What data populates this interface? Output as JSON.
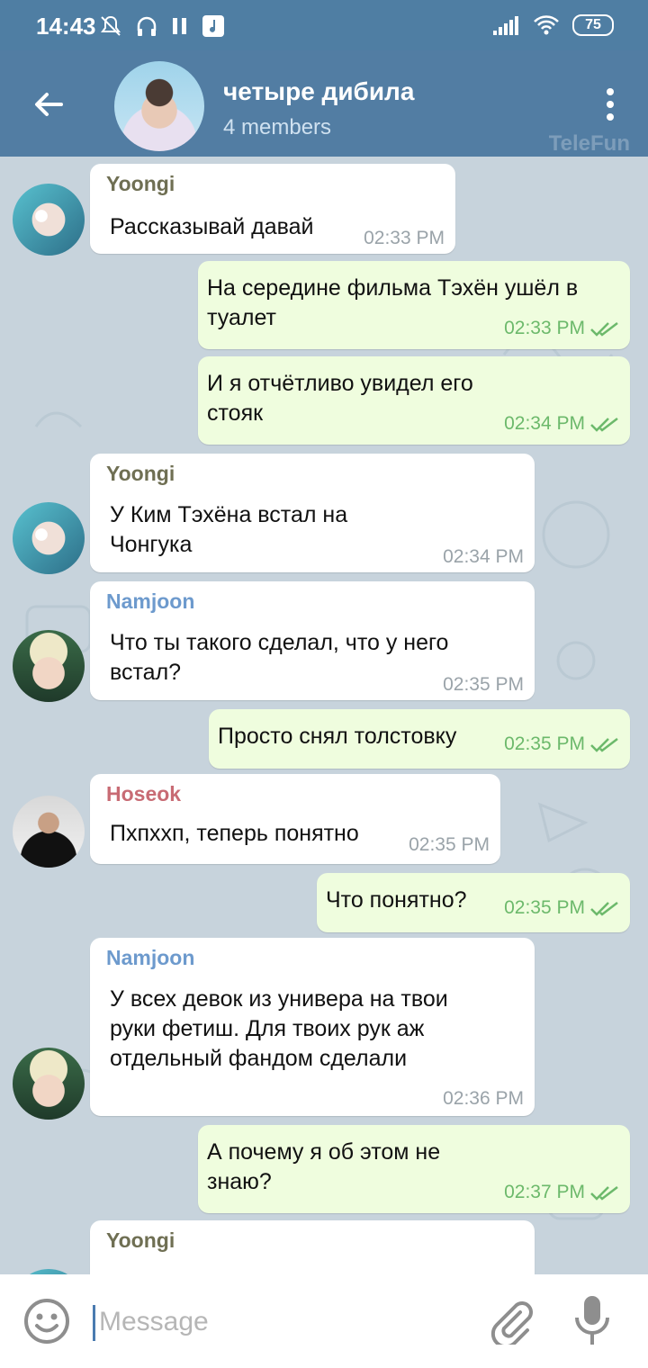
{
  "status_bar": {
    "time": "14:43",
    "battery": "75"
  },
  "header": {
    "title": "четыре дибила",
    "subtitle": "4 members",
    "watermark": "TeleFun"
  },
  "messages": [
    {
      "dir": "in",
      "sender": "Yoongi",
      "text": "Рассказывай давай",
      "time": "02:33 PM"
    },
    {
      "dir": "out",
      "text": "На середине фильма Тэхён ушёл в туалет",
      "time": "02:33 PM"
    },
    {
      "dir": "out",
      "text": "И я отчётливо увидел его стояк",
      "time": "02:34 PM"
    },
    {
      "dir": "in",
      "sender": "Yoongi",
      "text": "У Ким Тэхёна встал на Чонгука",
      "time": "02:34 PM"
    },
    {
      "dir": "in",
      "sender": "Namjoon",
      "text": "Что ты такого сделал, что у него встал?",
      "time": "02:35 PM"
    },
    {
      "dir": "out",
      "text": "Просто снял толстовку",
      "time": "02:35 PM"
    },
    {
      "dir": "in",
      "sender": "Hoseok",
      "text": "Пхпххп, теперь понятно",
      "time": "02:35 PM"
    },
    {
      "dir": "out",
      "text": "Что понятно?",
      "time": "02:35 PM"
    },
    {
      "dir": "in",
      "sender": "Namjoon",
      "text": "У всех девок из универа на твои руки фетиш. Для твоих рук аж отдельный фандом сделали",
      "time": "02:36 PM"
    },
    {
      "dir": "out",
      "text": "А почему я об этом не знаю?",
      "time": "02:37 PM"
    },
    {
      "dir": "in",
      "sender": "Yoongi",
      "text": ""
    }
  ],
  "input": {
    "placeholder": "Message"
  },
  "colors": {
    "header_bg": "#527da3",
    "outgoing_bubble": "#effdde",
    "incoming_bubble": "#ffffff",
    "yoongi_name": "#6f6f53",
    "namjoon_name": "#6d9acd",
    "hoseok_name": "#c86b74",
    "read_check": "#6cb96b"
  },
  "icons": {
    "back": "arrow-left-icon",
    "menu": "more-vert-icon",
    "emoji": "smile-icon",
    "attach": "paperclip-icon",
    "mic": "microphone-icon"
  }
}
